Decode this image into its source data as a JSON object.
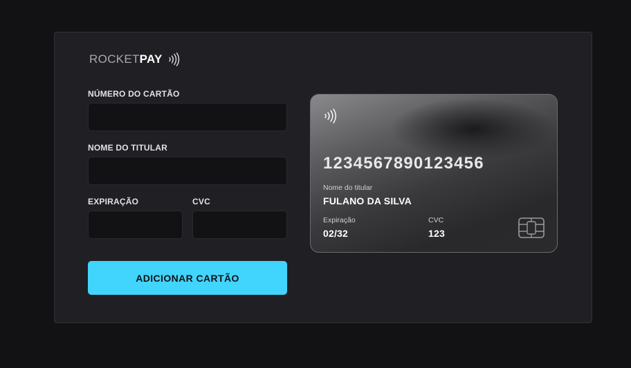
{
  "brand": {
    "rocket": "ROCKET",
    "pay": "PAY"
  },
  "form": {
    "card_number_label": "NÚMERO DO CARTÃO",
    "card_number_value": "",
    "holder_label": "NOME DO TITULAR",
    "holder_value": "",
    "expiry_label": "EXPIRAÇÃO",
    "expiry_value": "",
    "cvc_label": "CVC",
    "cvc_value": "",
    "submit_label": "ADICIONAR CARTÃO"
  },
  "card": {
    "number": "1234567890123456",
    "holder_label": "Nome do titular",
    "holder_name": "FULANO DA SILVA",
    "expiry_label": "Expiração",
    "expiry_value": "02/32",
    "cvc_label": "CVC",
    "cvc_value": "123"
  },
  "colors": {
    "background": "#121214",
    "panel": "#202024",
    "accent": "#41d4fd"
  }
}
